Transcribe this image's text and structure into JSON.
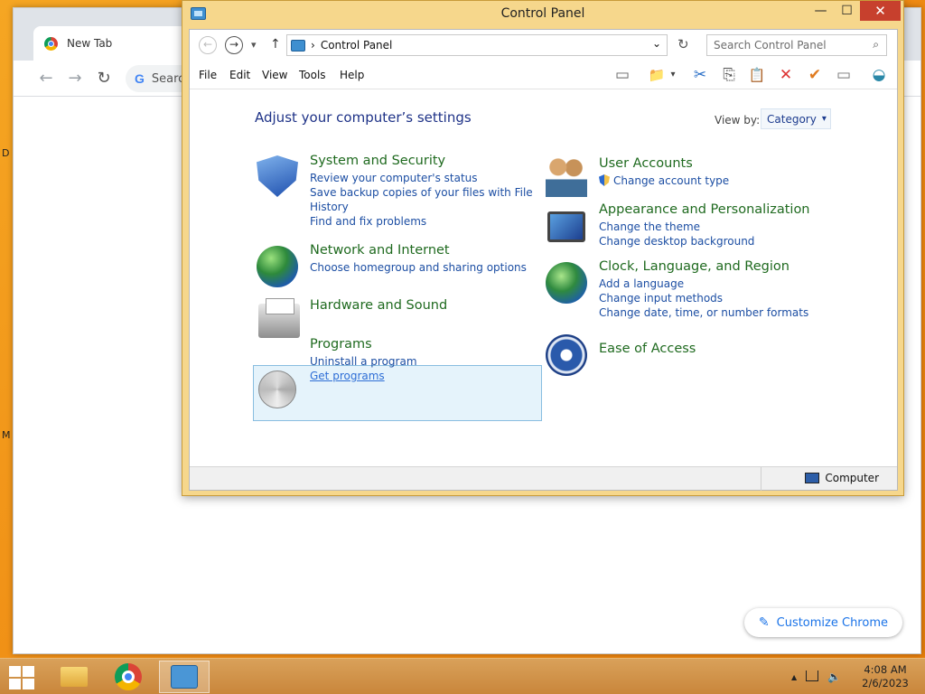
{
  "desktop": {
    "frag_d": "D",
    "frag_m": "M"
  },
  "chrome": {
    "tab_title": "New Tab",
    "omnibox_text": "Searc",
    "google_letter": "G",
    "customize_label": "Customize Chrome"
  },
  "window": {
    "title": "Control Panel",
    "minimize": "—",
    "maximize": "☐",
    "close": "✕"
  },
  "address": {
    "back": "←",
    "forward": "→",
    "recent": "▾",
    "up": "↑",
    "separator": "›",
    "path": "Control Panel",
    "dropdown": "⌄",
    "refresh": "↻",
    "search_placeholder": "Search Control Panel",
    "search_icon": "⌕"
  },
  "menu": [
    "File",
    "Edit",
    "View",
    "Tools",
    "Help"
  ],
  "toolbar_glyphs": {
    "layout": "▭",
    "folder": "📁",
    "drop": "▾",
    "cut": "✂",
    "copy": "⎘",
    "paste": "📋",
    "delete": "✕",
    "check": "✔",
    "props": "▭",
    "shell": "◒"
  },
  "content": {
    "heading": "Adjust your computer’s settings",
    "view_by_label": "View by:",
    "view_by_value": "Category",
    "view_by_arrow": "▾"
  },
  "categories": {
    "system": {
      "title": "System and Security",
      "links": [
        "Review your computer's status",
        "Save backup copies of your files with File",
        "History",
        "Find and fix problems"
      ]
    },
    "network": {
      "title": "Network and Internet",
      "links": [
        "Choose homegroup and sharing options"
      ]
    },
    "hardware": {
      "title": "Hardware and Sound"
    },
    "programs": {
      "title": "Programs",
      "links": [
        "Uninstall a program",
        "Get programs"
      ]
    },
    "users": {
      "title": "User Accounts",
      "links": [
        "Change account type"
      ]
    },
    "appearance": {
      "title": "Appearance and Personalization",
      "links": [
        "Change the theme",
        "Change desktop background"
      ]
    },
    "clock": {
      "title": "Clock, Language, and Region",
      "links": [
        "Add a language",
        "Change input methods",
        "Change date, time, or number formats"
      ]
    },
    "ease": {
      "title": "Ease of Access"
    }
  },
  "statusbar": {
    "computer": "Computer"
  },
  "taskbar": {
    "tray_arrow": "▲",
    "time": "4:08 AM",
    "date": "2/6/2023"
  },
  "colors": {
    "accent_gold": "#f6d78c",
    "link_blue": "#1c4ea3",
    "title_green": "#1f6a1f",
    "close_red": "#c7402d"
  }
}
